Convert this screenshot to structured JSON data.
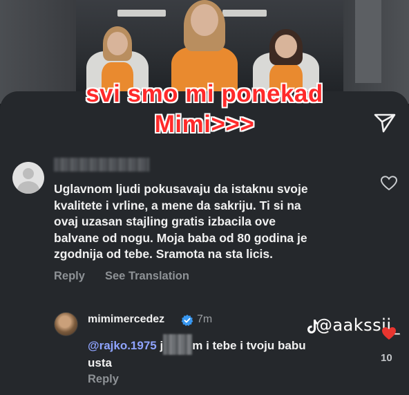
{
  "caption": {
    "line1": "svi smo mi ponekad",
    "line2": "Mimi>>>"
  },
  "comment": {
    "lines": [
      "Uglavnom ljudi pokusavaju da istaknu svoje",
      "kvalitete i vrline, a mene da sakriju. Ti si na",
      "ovaj uzasan stajling gratis izbacila ove",
      "balvane od nogu. Moja baba od 80 godina je",
      "zgodnija od tebe. Sramota na sta licis."
    ],
    "reply_label": "Reply",
    "translate_label": "See Translation"
  },
  "reply": {
    "username": "mimimercedez",
    "time": "7m",
    "mention": "@rajko.1975",
    "text_after": "m i tebe i tvoju babu",
    "text_line2": "usta",
    "j": "j",
    "reply_label": "Reply",
    "like_count": "10"
  },
  "watermark": {
    "handle": "@aakssii_"
  },
  "icons": {
    "share": "send-icon",
    "like": "heart-outline-icon",
    "verified": "verified-badge-icon",
    "tiktok": "tiktok-logo-icon"
  },
  "colors": {
    "sheet": "#25282c",
    "caption": "#ff2a2a",
    "mention": "#8fa4ff",
    "verified": "#3897f0",
    "liked": "#e8352f"
  }
}
